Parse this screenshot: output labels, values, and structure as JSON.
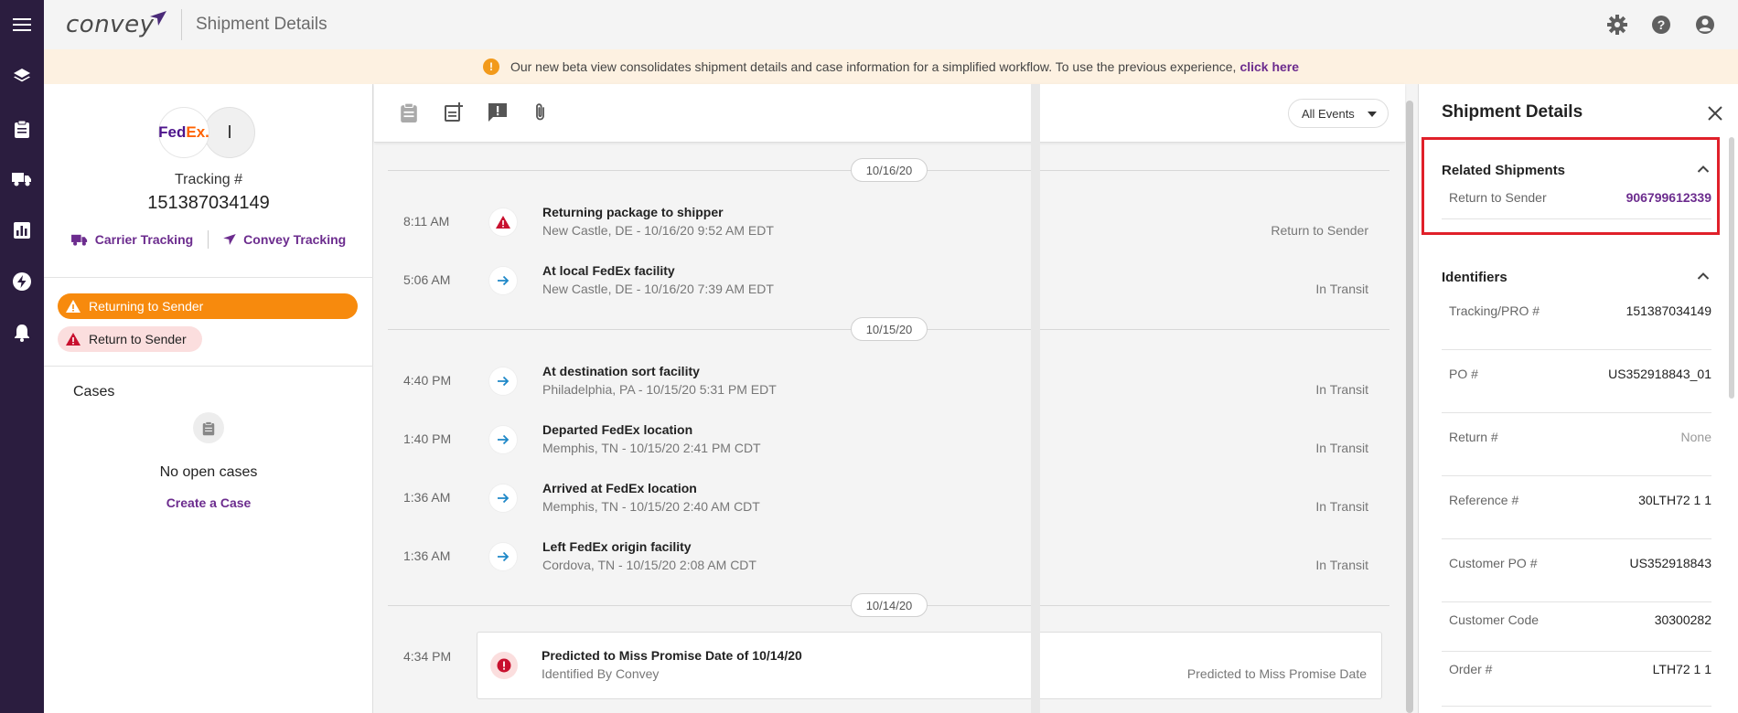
{
  "header": {
    "logo_text": "convey",
    "title": "Shipment Details",
    "icons": [
      "settings-icon",
      "help-icon",
      "account-icon"
    ]
  },
  "banner": {
    "message": "Our new beta view consolidates shipment details and case information for a simplified workflow. To use the previous experience,",
    "link_text": "click here"
  },
  "left_panel": {
    "carrier_logo_fed": "Fed",
    "carrier_logo_ex": "Ex.",
    "secondary_logo": "I",
    "tracking_label": "Tracking #",
    "tracking_number": "151387034149",
    "carrier_tracking": "Carrier Tracking",
    "convey_tracking": "Convey Tracking",
    "status_primary": "Returning to Sender",
    "status_secondary": "Return to Sender",
    "cases_title": "Cases",
    "no_cases": "No open cases",
    "create_case": "Create a Case"
  },
  "timeline": {
    "filter": "All Events",
    "dates": [
      "10/16/20",
      "10/15/20",
      "10/14/20"
    ],
    "events": [
      {
        "time": "8:11 AM",
        "title": "Returning package to shipper",
        "subtitle": "New Castle, DE - 10/16/20 9:52 AM EDT",
        "status": "Return to Sender",
        "icon": "warning-icon"
      },
      {
        "time": "5:06 AM",
        "title": "At local FedEx facility",
        "subtitle": "New Castle, DE - 10/16/20 7:39 AM EDT",
        "status": "In Transit",
        "icon": "arrow-right-icon"
      },
      {
        "time": "4:40 PM",
        "title": "At destination sort facility",
        "subtitle": "Philadelphia, PA - 10/15/20 5:31 PM EDT",
        "status": "In Transit",
        "icon": "arrow-right-icon"
      },
      {
        "time": "1:40 PM",
        "title": "Departed FedEx location",
        "subtitle": "Memphis, TN - 10/15/20 2:41 PM CDT",
        "status": "In Transit",
        "icon": "arrow-right-icon"
      },
      {
        "time": "1:36 AM",
        "title": "Arrived at FedEx location",
        "subtitle": "Memphis, TN - 10/15/20 2:40 AM CDT",
        "status": "In Transit",
        "icon": "arrow-right-icon"
      },
      {
        "time": "1:36 AM",
        "title": "Left FedEx origin facility",
        "subtitle": "Cordova, TN - 10/15/20 2:08 AM CDT",
        "status": "In Transit",
        "icon": "arrow-right-icon"
      }
    ],
    "predicted": {
      "time": "4:34 PM",
      "title": "Predicted to Miss Promise Date of 10/14/20",
      "subtitle": "Identified By Convey",
      "status": "Predicted to Miss Promise Date",
      "icon": "alert-icon"
    }
  },
  "right_panel": {
    "title": "Shipment Details",
    "related_title": "Related Shipments",
    "related": {
      "key": "Return to Sender",
      "value": "906799612339"
    },
    "identifiers_title": "Identifiers",
    "identifiers": [
      {
        "key": "Tracking/PRO #",
        "value": "151387034149"
      },
      {
        "key": "PO #",
        "value": "US352918843_01"
      },
      {
        "key": "Return #",
        "value": "None"
      },
      {
        "key": "Reference #",
        "value": "30LTH72 1 1"
      },
      {
        "key": "Customer PO #",
        "value": "US352918843"
      },
      {
        "key": "Customer Code",
        "value": "30300282"
      },
      {
        "key": "Order #",
        "value": "LTH72 1 1"
      }
    ]
  },
  "colors": {
    "brand_purple": "#6c2c8e",
    "rail": "#2b1d3f",
    "status_orange": "#f78a0d",
    "alert_red": "#c8102e",
    "link_blue": "#1e88c8",
    "highlight_red": "#e0202a"
  }
}
